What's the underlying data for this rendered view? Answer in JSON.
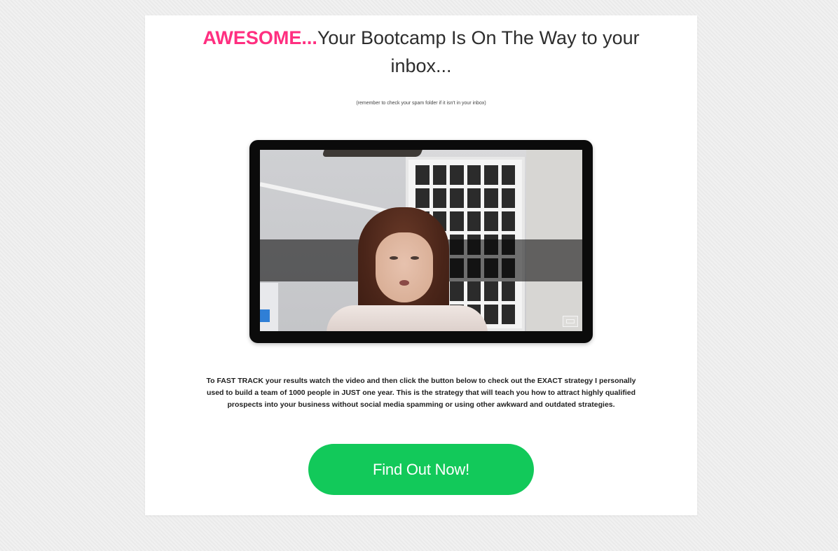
{
  "headline": {
    "accent": "AWESOME...",
    "rest": "Your Bootcamp Is On The Way to your inbox..."
  },
  "subnote": "(remember to check your spam folder if it isn't in your inbox)",
  "video": {
    "fullscreen_icon": "fullscreen-icon",
    "thumbnail_description": "woman speaking to camera"
  },
  "body_text": "To FAST TRACK your results watch the video and then click the button below to check out the EXACT strategy I personally used to build a team of 1000 people in JUST one year. This is the strategy that will teach you how to attract highly qualified prospects into your business without social media spamming or using other awkward and outdated strategies.",
  "cta": {
    "label": "Find Out Now!"
  },
  "colors": {
    "accent": "#ff2f80",
    "cta_bg": "#12c95a",
    "page_bg": "#eeeeee",
    "card_bg": "#ffffff"
  }
}
